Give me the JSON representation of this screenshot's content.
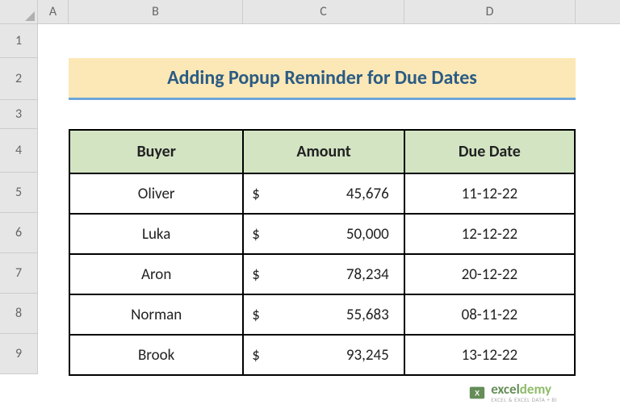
{
  "columns": {
    "A": "A",
    "B": "B",
    "C": "C",
    "D": "D"
  },
  "rows": {
    "r1": "1",
    "r2": "2",
    "r3": "3",
    "r4": "4",
    "r5": "5",
    "r6": "6",
    "r7": "7",
    "r8": "8",
    "r9": "9"
  },
  "title": "Adding Popup Reminder for Due Dates",
  "headers": {
    "buyer": "Buyer",
    "amount": "Amount",
    "due": "Due Date"
  },
  "currency": "$",
  "table": [
    {
      "buyer": "Oliver",
      "amount": "45,676",
      "due": "11-12-22"
    },
    {
      "buyer": "Luka",
      "amount": "50,000",
      "due": "12-12-22"
    },
    {
      "buyer": "Aron",
      "amount": "78,234",
      "due": "20-12-22"
    },
    {
      "buyer": "Norman",
      "amount": "55,683",
      "due": "08-11-22"
    },
    {
      "buyer": "Brook",
      "amount": "93,245",
      "due": "13-12-22"
    }
  ],
  "watermark": {
    "brand1": "excel",
    "brand2": "demy",
    "sub": "EXCEL & EXCEL DATA + BI"
  },
  "chart_data": {
    "type": "table",
    "title": "Adding Popup Reminder for Due Dates",
    "columns": [
      "Buyer",
      "Amount",
      "Due Date"
    ],
    "rows": [
      [
        "Oliver",
        45676,
        "11-12-22"
      ],
      [
        "Luka",
        50000,
        "12-12-22"
      ],
      [
        "Aron",
        78234,
        "20-12-22"
      ],
      [
        "Norman",
        55683,
        "08-11-22"
      ],
      [
        "Brook",
        93245,
        "13-12-22"
      ]
    ]
  }
}
